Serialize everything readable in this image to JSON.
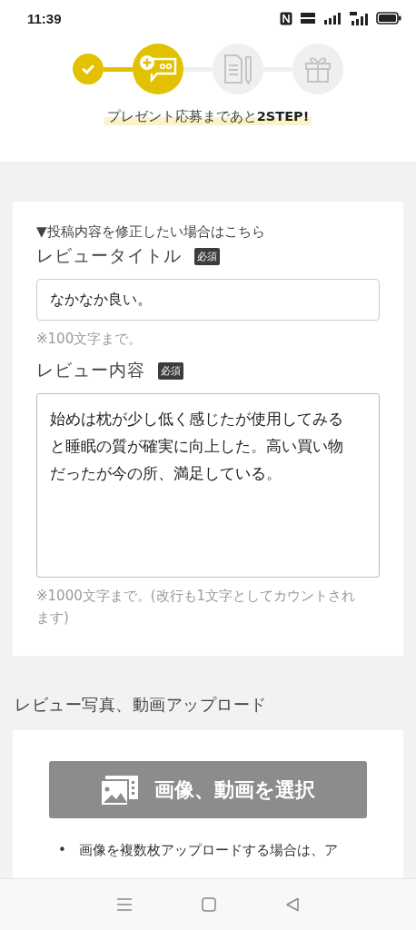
{
  "status_bar": {
    "time": "11:39"
  },
  "steps": [
    {
      "completed": true,
      "selected": false
    },
    {
      "completed": false,
      "selected": true
    },
    {
      "completed": false,
      "selected": false
    },
    {
      "completed": false,
      "selected": false
    }
  ],
  "banner": "プレゼント応募まであと**2STEP!**",
  "review_form": {
    "toggle": "▼投稿内容を修正したい場合はこちら",
    "fields": [
      {
        "kind": "input",
        "label": "レビュータイトル",
        "badge": "必須",
        "value": "なかなか良い。",
        "hint": "※100文字まで。"
      },
      {
        "kind": "textarea",
        "label": "レビュー内容",
        "badge": "必須",
        "value": "始めは枕が少し低く感じたが使用してみると睡眠の質が確実に向上した。高い買い物だったが今の所、満足している。",
        "hint": "※1000文字まで。(改行も1文字としてカウントされます)"
      }
    ]
  },
  "upload": {
    "heading": "レビュー写真、動画アップロード",
    "button": "画像、動画を選択",
    "notes": [
      {
        "bullet": "•",
        "text": "画像を複数枚アップロードする場合は、ア"
      }
    ]
  }
}
